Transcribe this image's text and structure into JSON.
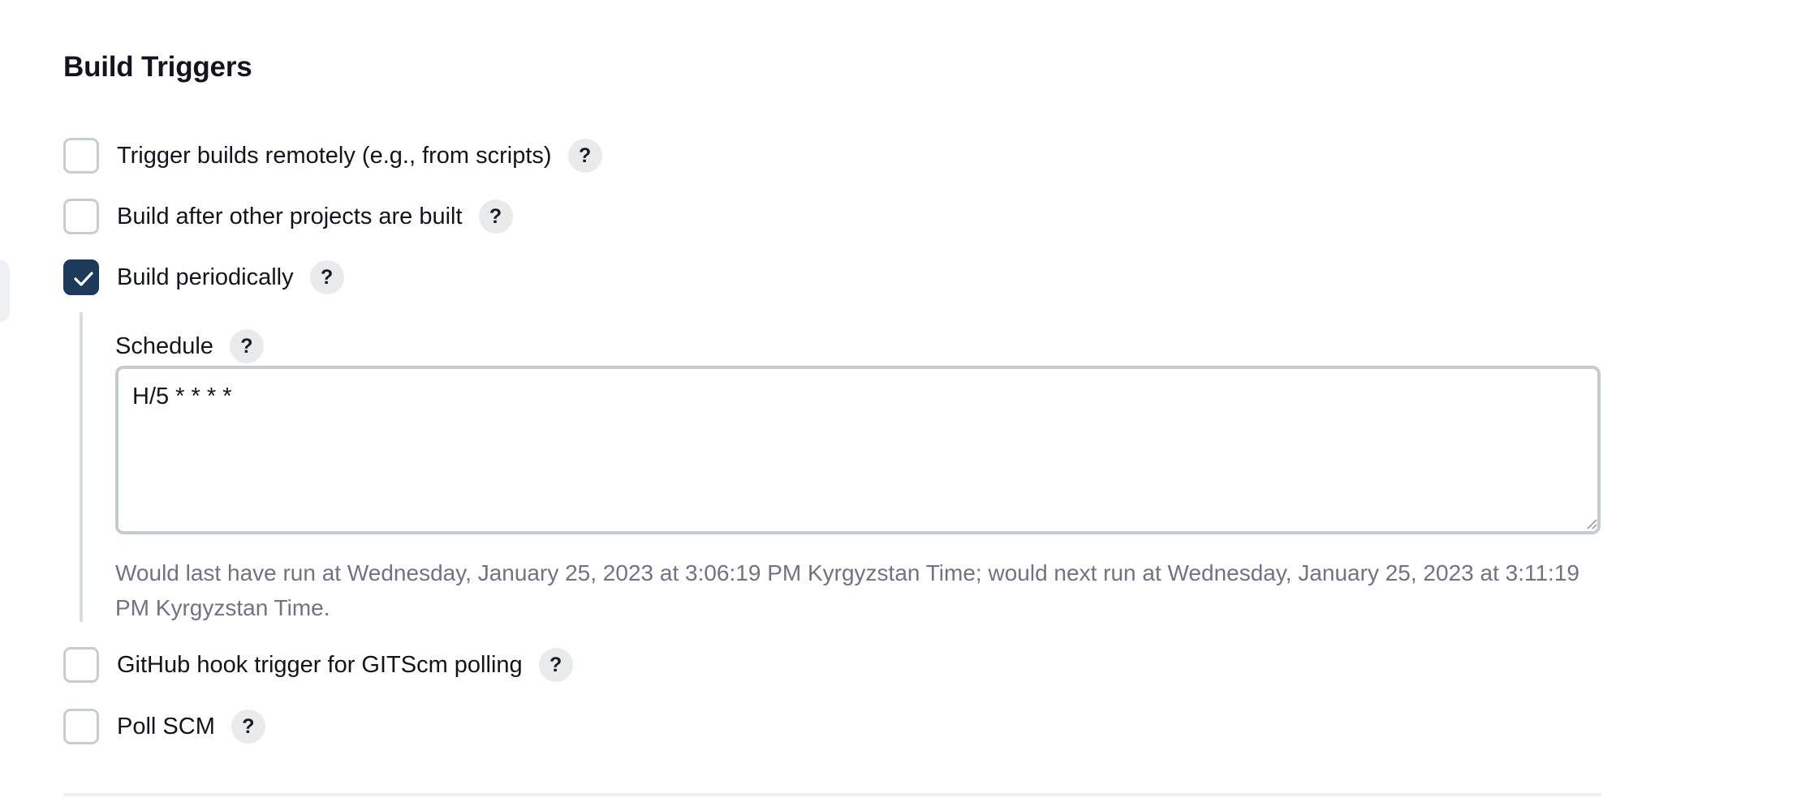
{
  "section": {
    "title": "Build Triggers"
  },
  "triggers": [
    {
      "label": "Trigger builds remotely (e.g., from scripts)",
      "checked": false,
      "help": "?"
    },
    {
      "label": "Build after other projects are built",
      "checked": false,
      "help": "?"
    },
    {
      "label": "Build periodically",
      "checked": true,
      "help": "?"
    },
    {
      "label": "GitHub hook trigger for GITScm polling",
      "checked": false,
      "help": "?"
    },
    {
      "label": "Poll SCM",
      "checked": false,
      "help": "?"
    }
  ],
  "schedule": {
    "label": "Schedule",
    "help": "?",
    "value": "H/5 * * * *",
    "hint": "Would last have run at Wednesday, January 25, 2023 at 3:06:19 PM Kyrgyzstan Time; would next run at Wednesday, January 25, 2023 at 3:11:19 PM Kyrgyzstan Time."
  },
  "colors": {
    "checkbox_checked": "#1e3a5a",
    "checkbox_border": "#c7ccd1",
    "hint_text": "#6f7383",
    "help_bg": "#e9eaec"
  },
  "icons": {
    "checkmark": "check-icon",
    "help": "question-mark"
  }
}
